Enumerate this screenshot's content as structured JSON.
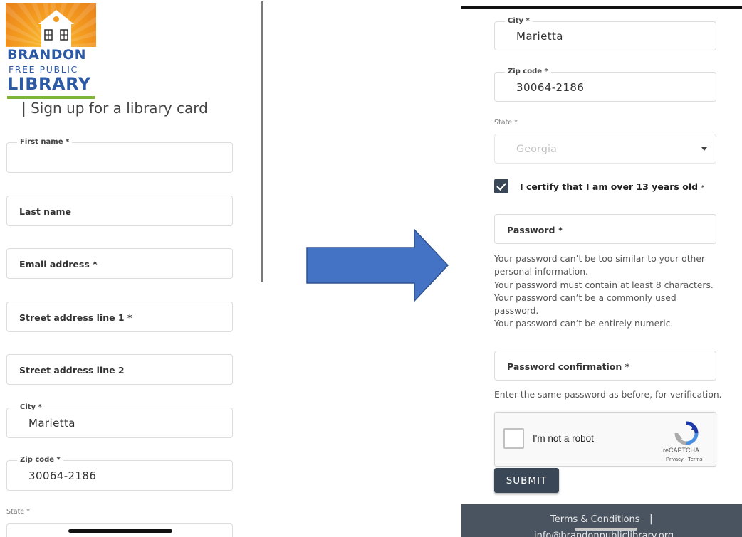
{
  "left": {
    "logo": {
      "word1": "BRANDON",
      "word2": "FREE PUBLIC",
      "word3": "LIBRARY"
    },
    "page_title": "| Sign up for a library card",
    "fields": {
      "first_name": {
        "label": "First name *",
        "value": ""
      },
      "last_name": {
        "placeholder": "Last name"
      },
      "email": {
        "placeholder": "Email address *"
      },
      "street1": {
        "placeholder": "Street address line 1 *"
      },
      "street2": {
        "placeholder": "Street address line 2"
      },
      "city": {
        "label": "City *",
        "value": "Marietta"
      },
      "zip": {
        "label": "Zip code *",
        "value": "30064-2186"
      },
      "state": {
        "label": "State *"
      }
    }
  },
  "right": {
    "city": {
      "label": "City *",
      "value": "Marietta"
    },
    "zip": {
      "label": "Zip code *",
      "value": "30064-2186"
    },
    "state": {
      "label": "State *",
      "value": "Georgia"
    },
    "certify": {
      "label": "I certify that I am over 13 years old",
      "required": "*",
      "checked": true
    },
    "password": {
      "placeholder": "Password *"
    },
    "password_help": [
      "Your password can’t be too similar to your other",
      "personal information.",
      "Your password must contain at least 8 characters.",
      "Your password can’t be a commonly used",
      "password.",
      "Your password can’t be entirely numeric."
    ],
    "password_confirm": {
      "placeholder": "Password confirmation *"
    },
    "confirm_help": "Enter the same password as before, for verification.",
    "captcha": {
      "label": "I'm not a robot",
      "brand": "reCAPTCHA",
      "links": "Privacy - Terms"
    },
    "submit_label": "SUBMIT",
    "footer": {
      "terms": "Terms & Conditions",
      "separator": "|",
      "email": "info@brandonpubliclibrary.org"
    }
  },
  "colors": {
    "brand_blue": "#2d5aa5",
    "button": "#3a4756",
    "arrow": "#4472c4",
    "footer": "#4a5460"
  }
}
